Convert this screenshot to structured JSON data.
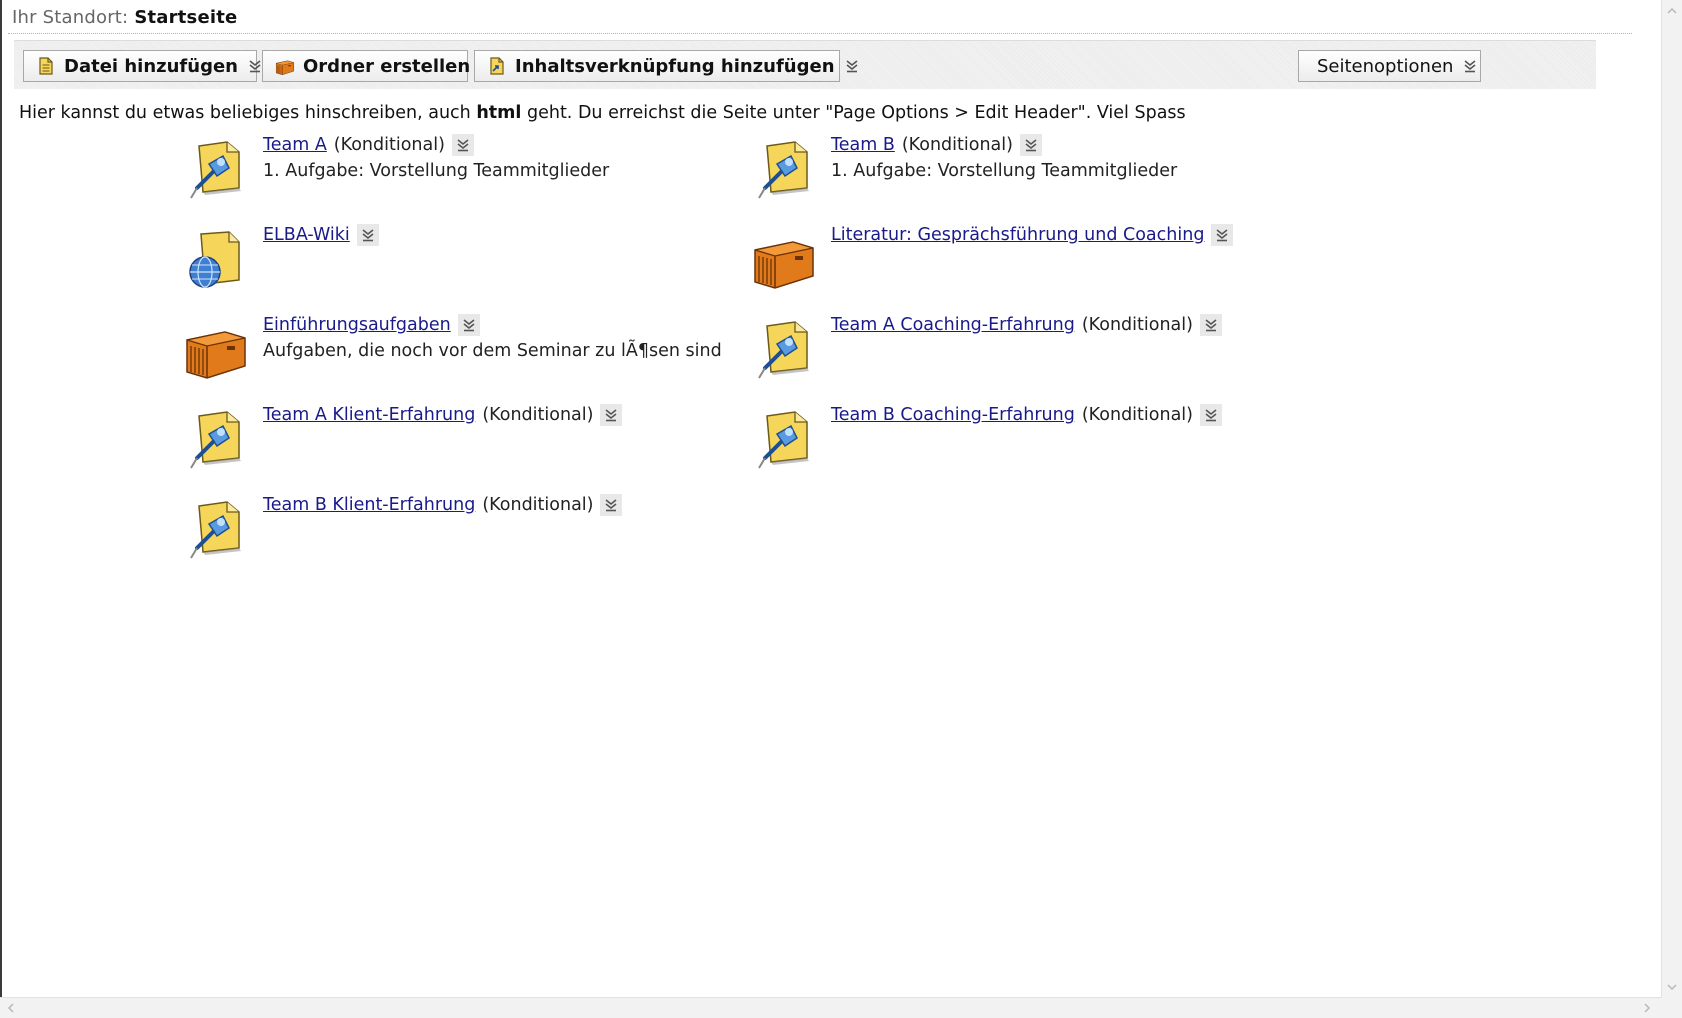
{
  "breadcrumb": {
    "label": "Ihr Standort:",
    "current": "Startseite"
  },
  "toolbar": {
    "add_file_label": "Datei hinzufügen",
    "create_folder_label": "Ordner erstellen",
    "add_link_label": "Inhaltsverknüpfung hinzufügen",
    "page_options_label": "Seitenoptionen"
  },
  "header": {
    "text_before": "Hier kannst du etwas beliebiges hinschreiben, auch",
    "text_bold": "html",
    "text_after": "geht. Du erreichst die Seite unter \"Page Options > Edit Header\". Viel Spass"
  },
  "items": [
    {
      "title": "Team A",
      "suffix": "(Konditional)",
      "desc": "1. Aufgabe: Vorstellung Teammitglieder",
      "icon": "pushpin-document-icon"
    },
    {
      "title": "Team B",
      "suffix": "(Konditional)",
      "desc": "1. Aufgabe: Vorstellung Teammitglieder",
      "icon": "pushpin-document-icon"
    },
    {
      "title": "ELBA-Wiki",
      "suffix": "",
      "desc": "",
      "icon": "globe-document-icon"
    },
    {
      "title": "Literatur: Gesprächsführung und Coaching",
      "suffix": "",
      "desc": "",
      "icon": "folder-box-icon"
    },
    {
      "title": "Einführungsaufgaben",
      "suffix": "",
      "desc": "Aufgaben, die noch vor dem Seminar zu lÃ¶sen sind",
      "icon": "folder-box-icon"
    },
    {
      "title": "Team A Coaching-Erfahrung",
      "suffix": "(Konditional)",
      "desc": "",
      "icon": "pushpin-document-icon"
    },
    {
      "title": "Team A Klient-Erfahrung",
      "suffix": "(Konditional)",
      "desc": "",
      "icon": "pushpin-document-icon"
    },
    {
      "title": "Team B Coaching-Erfahrung",
      "suffix": "(Konditional)",
      "desc": "",
      "icon": "pushpin-document-icon"
    },
    {
      "title": "Team B Klient-Erfahrung",
      "suffix": "(Konditional)",
      "desc": "",
      "icon": "pushpin-document-icon"
    }
  ],
  "colors": {
    "link": "#1a1a8a",
    "folder_orange": "#e07a1a",
    "document_yellow": "#f6d65a",
    "pushpin_blue": "#3f7fd0"
  }
}
